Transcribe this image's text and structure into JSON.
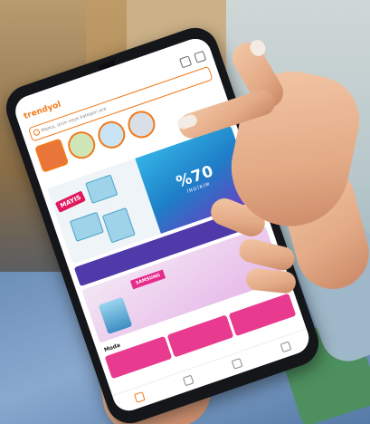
{
  "app": {
    "logo_text": "trendyol",
    "search_placeholder": "Marka, ürün veya kategori ara"
  },
  "stories": [
    {
      "label": ""
    },
    {
      "label": ""
    },
    {
      "label": ""
    },
    {
      "label": ""
    }
  ],
  "promo": {
    "badge": "MAYIS",
    "discount": "%70",
    "discount_sub": "İNDİRİM"
  },
  "banner": {
    "text": ""
  },
  "samsung": {
    "brand": "SAMSUNG",
    "sub": ""
  },
  "section_title": "Moda",
  "tabs": [
    {
      "label": ""
    },
    {
      "label": ""
    },
    {
      "label": ""
    },
    {
      "label": ""
    }
  ],
  "colors": {
    "brand": "#f27a1a",
    "promo_pink": "#e2175b",
    "jeans": "#6c8fb8"
  }
}
